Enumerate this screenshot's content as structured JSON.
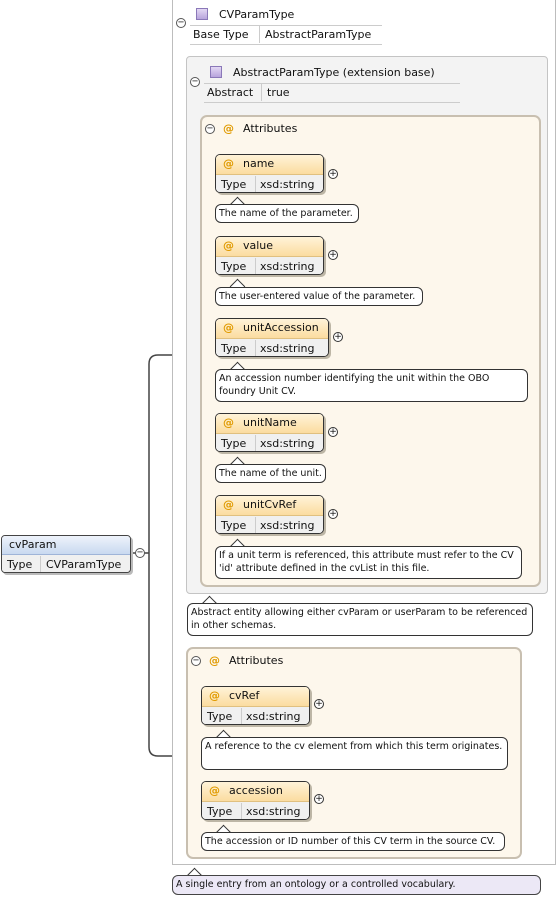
{
  "element": {
    "name": "cvParam",
    "type_key": "Type",
    "type_value": "CVParamType"
  },
  "complex_type": {
    "name": "CVParamType",
    "base_key": "Base Type",
    "base_value": "AbstractParamType"
  },
  "extension": {
    "title": "AbstractParamType (extension base)",
    "abstract_key": "Abstract",
    "abstract_value": "true"
  },
  "attributes_group_1": {
    "label": "Attributes",
    "items": [
      {
        "name": "name",
        "type_key": "Type",
        "type_value": "xsd:string",
        "doc": "The name of the parameter."
      },
      {
        "name": "value",
        "type_key": "Type",
        "type_value": "xsd:string",
        "doc": "The user-entered value of the parameter."
      },
      {
        "name": "unitAccession",
        "type_key": "Type",
        "type_value": "xsd:string",
        "doc": "An accession number identifying the unit within the OBO foundry Unit CV."
      },
      {
        "name": "unitName",
        "type_key": "Type",
        "type_value": "xsd:string",
        "doc": "The name of the unit."
      },
      {
        "name": "unitCvRef",
        "type_key": "Type",
        "type_value": "xsd:string",
        "doc": "If a unit term is referenced, this attribute must refer to the CV 'id' attribute defined in the cvList in this file."
      }
    ]
  },
  "extension_doc": "Abstract entity allowing either cvParam or userParam to be referenced in other schemas.",
  "attributes_group_2": {
    "label": "Attributes",
    "items": [
      {
        "name": "cvRef",
        "type_key": "Type",
        "type_value": "xsd:string",
        "doc": "A reference to the cv element from which this term originates."
      },
      {
        "name": "accession",
        "type_key": "Type",
        "type_value": "xsd:string",
        "doc": "The accession or ID number of this CV term in the source CV."
      }
    ]
  },
  "element_doc": "A single entry from an ontology or a controlled vocabulary.",
  "symbols": {
    "attribute_marker": "@",
    "expanded": "−",
    "collapsed": "+"
  }
}
